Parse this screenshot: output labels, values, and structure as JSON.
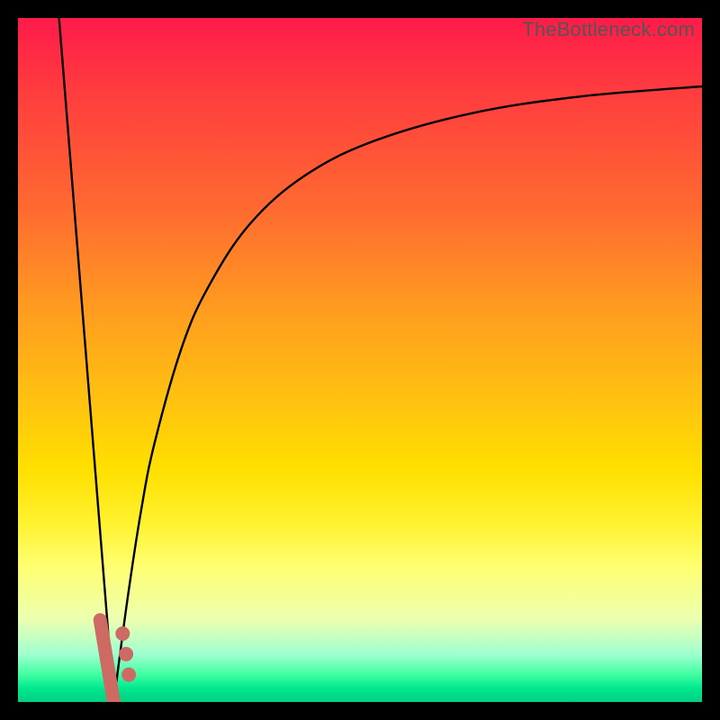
{
  "watermark": "TheBottleneck.com",
  "chart_data": {
    "type": "line",
    "title": "",
    "xlabel": "",
    "ylabel": "",
    "xlim": [
      0,
      100
    ],
    "ylim": [
      0,
      100
    ],
    "grid": false,
    "legend": false,
    "notes": "Bottleneck percentage curve with colored performance gradient background. Y axis: bottleneck percentage (top=100, bottom=0). Minimum near x≈14. Right branch rises asymptotically toward ~90%.",
    "series": [
      {
        "name": "left-branch",
        "x": [
          6,
          8,
          10,
          12,
          14
        ],
        "y": [
          100,
          75,
          50,
          25,
          0
        ]
      },
      {
        "name": "right-branch",
        "x": [
          14,
          16,
          18,
          20,
          24,
          28,
          34,
          42,
          52,
          66,
          82,
          100
        ],
        "y": [
          0,
          15,
          28,
          38,
          52,
          61,
          70,
          77,
          82,
          86,
          88.5,
          90
        ]
      }
    ],
    "markers": {
      "name": "highlight-beads",
      "x": [
        15.3,
        15.8,
        16.2
      ],
      "y": [
        10,
        7,
        4
      ]
    },
    "left_tail_highlight": {
      "x": [
        12.0,
        14.0
      ],
      "y": [
        12,
        0
      ]
    }
  }
}
